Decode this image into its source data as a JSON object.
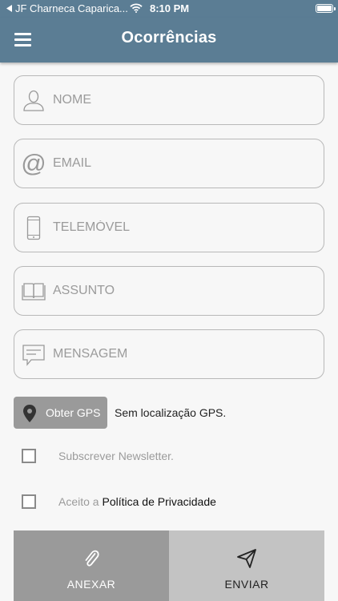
{
  "status_bar": {
    "carrier": "JF Charneca Caparica...",
    "time": "8:10 PM"
  },
  "header": {
    "title": "Ocorrências"
  },
  "form": {
    "nome_placeholder": "NOME",
    "email_placeholder": "EMAIL",
    "telemovel_placeholder": "TELEMÓVEL",
    "assunto_placeholder": "ASSUNTO",
    "mensagem_placeholder": "MENSAGEM"
  },
  "gps": {
    "button_label": "Obter GPS",
    "status_text": "Sem localização GPS."
  },
  "newsletter": {
    "label": "Subscrever Newsletter.",
    "checked": false
  },
  "privacy": {
    "label_prefix": "Aceito a",
    "link_text": "Política de Privacidade",
    "checked": false
  },
  "actions": {
    "attach_label": "ANEXAR",
    "send_label": "ENVIAR"
  },
  "colors": {
    "header_bg": "#5b7d94",
    "attach_bg": "#9a9a9a",
    "send_bg": "#c3c3c3",
    "gps_bg": "#9a9a9a"
  }
}
